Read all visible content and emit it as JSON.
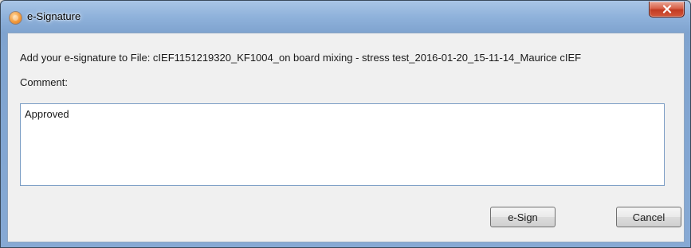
{
  "window": {
    "title": "e-Signature",
    "icon": "app-logo-icon",
    "close_icon": "close-icon"
  },
  "dialog": {
    "prompt": "Add your e-signature to File: cIEF1151219320_KF1004_on board mixing - stress test_2016-01-20_15-11-14_Maurice cIEF",
    "comment_label": "Comment:",
    "comment_value": "Approved"
  },
  "buttons": {
    "esign_label": "e-Sign",
    "cancel_label": "Cancel"
  },
  "colors": {
    "titlebar": "#8fb2db",
    "close_button": "#c13b22",
    "client_background": "#f0f0f0",
    "input_border": "#7a9cc4"
  }
}
